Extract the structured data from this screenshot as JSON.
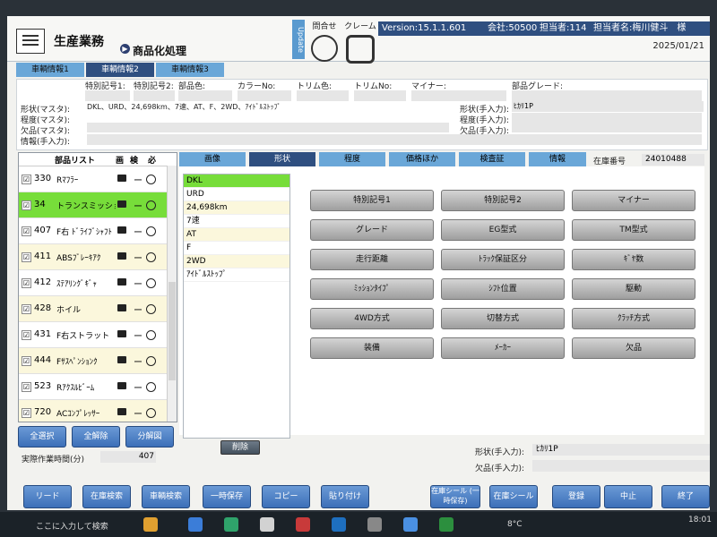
{
  "header": {
    "app_title": "生産業務",
    "sub_title": "商品化処理",
    "update_label": "Update",
    "icons": [
      {
        "name": "inquiry",
        "label": "問合せ",
        "icon": "steering-wheel-icon"
      },
      {
        "name": "claim",
        "label": "クレーム",
        "icon": "tire-icon"
      }
    ],
    "version": "Version:15.1.1.601",
    "company": "会社:50500",
    "person": "担当者:114",
    "person_name": "担当者名:梅川健斗　様",
    "date": "2025/01/21"
  },
  "vehicle_tabs": [
    "車輌情報1",
    "車輌情報2",
    "車輌情報3"
  ],
  "info": {
    "row1_labels": [
      "特別記号1:",
      "特別記号2:",
      "部品色:",
      "カラーNo:",
      "トリム色:",
      "トリムNo:",
      "マイナー:",
      "部品グレード:"
    ],
    "keitai_master_label": "形状(マスタ):",
    "keitai_master_value": "DKL、URD、24,698km、7速、AT、F、2WD、ｱｲﾄﾞﾙｽﾄｯﾌﾟ",
    "teido_master_label": "程度(マスタ):",
    "ketsuhin_master_label": "欠品(マスタ):",
    "joho_manual_label": "情報(手入力):",
    "keitai_manual_label": "形状(手入力):",
    "keitai_manual_value": "ﾋｶﾘ1P",
    "teido_manual_label": "程度(手入力):",
    "ketsuhin_manual_label": "欠品(手入力):"
  },
  "parts_list": {
    "headers": [
      "部品リスト",
      "画",
      "検",
      "必"
    ],
    "rows": [
      {
        "num": "330",
        "name": "Rﾏﾌﾗｰ",
        "check": "☑",
        "dash": "ー",
        "selected": false
      },
      {
        "num": "34",
        "name": "トランスミッション",
        "check": "☑",
        "dash": "ー",
        "selected": true
      },
      {
        "num": "407",
        "name": "F右 ﾄﾞﾗｲﾌﾞｼｬﾌﾄ",
        "check": "☑",
        "dash": "ー",
        "selected": false
      },
      {
        "num": "411",
        "name": "ABSﾌﾞﾚｰｷｱｸ",
        "check": "☑",
        "dash": "ー",
        "selected": false
      },
      {
        "num": "412",
        "name": "ｽﾃｱﾘﾝｸﾞｷﾞｬ",
        "check": "☑",
        "dash": "ー",
        "selected": false
      },
      {
        "num": "428",
        "name": "ホイル",
        "check": "☑",
        "dash": "ー",
        "selected": false
      },
      {
        "num": "431",
        "name": "F右ストラット",
        "check": "☑",
        "dash": "ー",
        "selected": false
      },
      {
        "num": "444",
        "name": "Fｻｽﾍﾟﾝｼｮﾝｸ",
        "check": "☑",
        "dash": "ー",
        "selected": false
      },
      {
        "num": "523",
        "name": "Rｱｸｽﾙﾋﾞｰﾑ",
        "check": "☑",
        "dash": "ー",
        "selected": false
      },
      {
        "num": "720",
        "name": "ACｺﾝﾌﾟﾚｯｻｰ",
        "check": "☑",
        "dash": "ー",
        "selected": false
      }
    ],
    "select_all": "全選択",
    "clear_all": "全解除",
    "split_view": "分解図",
    "work_time_label": "実際作業時間(分)",
    "work_time_value": "407"
  },
  "detail_tabs": [
    "画像",
    "形状",
    "程度",
    "価格ほか",
    "検査証",
    "情報"
  ],
  "stock_label": "在庫番号",
  "stock_value": "24010488",
  "shape_values": [
    "DKL",
    "URD",
    "24,698km",
    "7速",
    "AT",
    "F",
    "2WD",
    "ｱｲﾄﾞﾙｽﾄｯﾌﾟ"
  ],
  "delete_button": "削除",
  "shape_buttons": [
    "特別記号1",
    "特別記号2",
    "マイナー",
    "グレード",
    "EG型式",
    "TM型式",
    "走行距離",
    "ﾄﾗｯｸ保証区分",
    "ｷﾞﾔ数",
    "ﾐｯｼｮﾝﾀｲﾌﾟ",
    "ｼﾌﾄ位置",
    "駆動",
    "4WD方式",
    "切替方式",
    "ｸﾗｯﾁ方式",
    "装備",
    "ﾒｰｶｰ",
    "欠品"
  ],
  "bottom_notes": {
    "keitai_label": "形状(手入力):",
    "keitai_value": "ﾋｶﾘ1P",
    "ketsuhin_label": "欠品(手入力):"
  },
  "bottom_buttons": [
    "リード",
    "在庫検索",
    "車輌検索",
    "一時保存",
    "コピー",
    "貼り付け",
    "在庫シール (一時保存)",
    "在庫シール",
    "登録",
    "中止",
    "終了"
  ],
  "taskbar": {
    "search_text": "ここに入力して検索",
    "temperature": "8°C",
    "time": "18:01"
  },
  "colors": {
    "selected_row": "#77dd3a",
    "header_blue": "#2f4f80",
    "tab_blue": "#6aa7d8"
  }
}
